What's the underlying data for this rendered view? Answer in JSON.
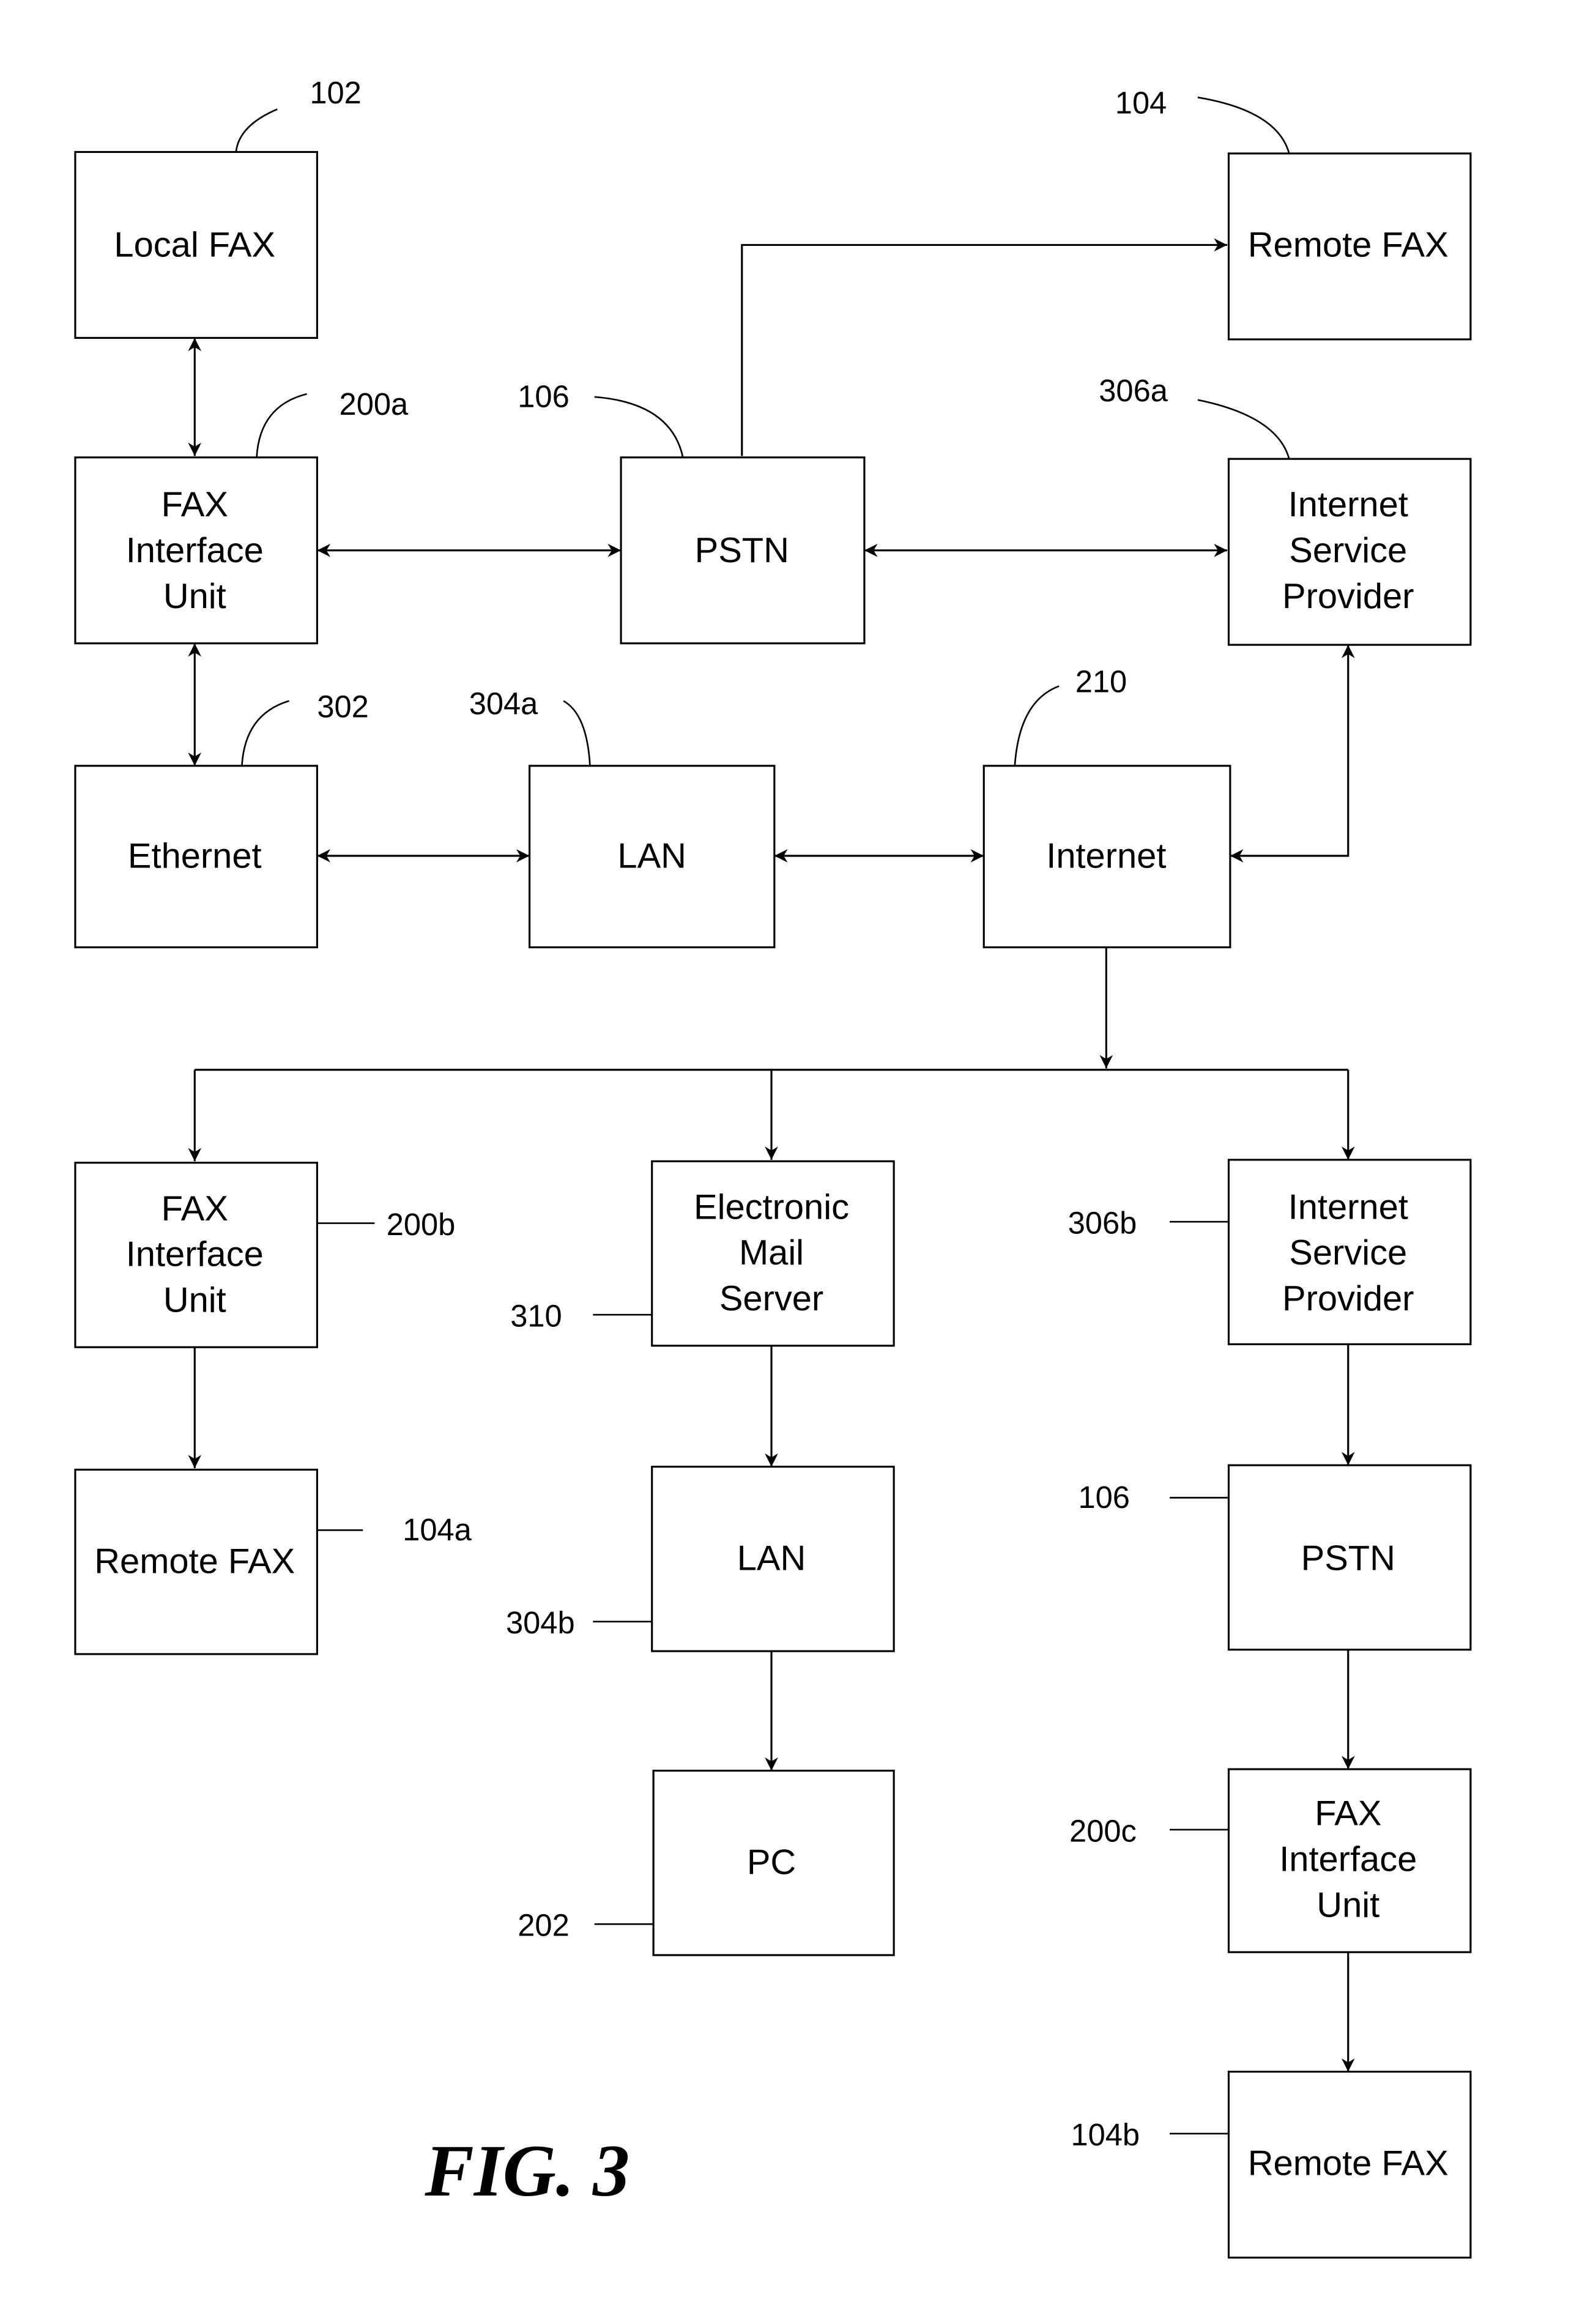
{
  "figure": {
    "caption": "FIG. 3"
  },
  "nodes": {
    "local_fax": {
      "lines": [
        "Local FAX"
      ],
      "ref": "102"
    },
    "remote_fax": {
      "lines": [
        "Remote FAX"
      ],
      "ref": "104"
    },
    "fiu_a": {
      "lines": [
        "FAX",
        "Interface",
        "Unit"
      ],
      "ref": "200a"
    },
    "pstn_top": {
      "lines": [
        "PSTN"
      ],
      "ref": "106"
    },
    "isp_a": {
      "lines": [
        "Internet",
        "Service",
        "Provider"
      ],
      "ref": "306a"
    },
    "ethernet": {
      "lines": [
        "Ethernet"
      ],
      "ref": "302"
    },
    "lan_a": {
      "lines": [
        "LAN"
      ],
      "ref": "304a"
    },
    "internet": {
      "lines": [
        "Internet"
      ],
      "ref": "210"
    },
    "fiu_b": {
      "lines": [
        "FAX",
        "Interface",
        "Unit"
      ],
      "ref": "200b"
    },
    "email": {
      "lines": [
        "Electronic",
        "Mail",
        "Server"
      ],
      "ref": "310"
    },
    "isp_b": {
      "lines": [
        "Internet",
        "Service",
        "Provider"
      ],
      "ref": "306b"
    },
    "remote_fax_a": {
      "lines": [
        "Remote FAX"
      ],
      "ref": "104a"
    },
    "lan_b": {
      "lines": [
        "LAN"
      ],
      "ref": "304b"
    },
    "pstn_b": {
      "lines": [
        "PSTN"
      ],
      "ref": "106"
    },
    "pc": {
      "lines": [
        "PC"
      ],
      "ref": "202"
    },
    "fiu_c": {
      "lines": [
        "FAX",
        "Interface",
        "Unit"
      ],
      "ref": "200c"
    },
    "remote_fax_b": {
      "lines": [
        "Remote FAX"
      ],
      "ref": "104b"
    }
  },
  "connections": [
    {
      "from": "local_fax",
      "to": "fiu_a",
      "direction": "bidirectional"
    },
    {
      "from": "fiu_a",
      "to": "pstn_top",
      "direction": "bidirectional"
    },
    {
      "from": "pstn_top",
      "to": "remote_fax",
      "direction": "forward"
    },
    {
      "from": "pstn_top",
      "to": "isp_a",
      "direction": "bidirectional"
    },
    {
      "from": "fiu_a",
      "to": "ethernet",
      "direction": "bidirectional"
    },
    {
      "from": "ethernet",
      "to": "lan_a",
      "direction": "bidirectional"
    },
    {
      "from": "lan_a",
      "to": "internet",
      "direction": "bidirectional"
    },
    {
      "from": "internet",
      "to": "isp_a",
      "direction": "bidirectional"
    },
    {
      "from": "internet",
      "to": "fiu_b",
      "direction": "forward"
    },
    {
      "from": "internet",
      "to": "email",
      "direction": "forward"
    },
    {
      "from": "internet",
      "to": "isp_b",
      "direction": "forward"
    },
    {
      "from": "fiu_b",
      "to": "remote_fax_a",
      "direction": "forward"
    },
    {
      "from": "email",
      "to": "lan_b",
      "direction": "forward"
    },
    {
      "from": "lan_b",
      "to": "pc",
      "direction": "forward"
    },
    {
      "from": "isp_b",
      "to": "pstn_b",
      "direction": "forward"
    },
    {
      "from": "pstn_b",
      "to": "fiu_c",
      "direction": "forward"
    },
    {
      "from": "fiu_c",
      "to": "remote_fax_b",
      "direction": "forward"
    }
  ]
}
